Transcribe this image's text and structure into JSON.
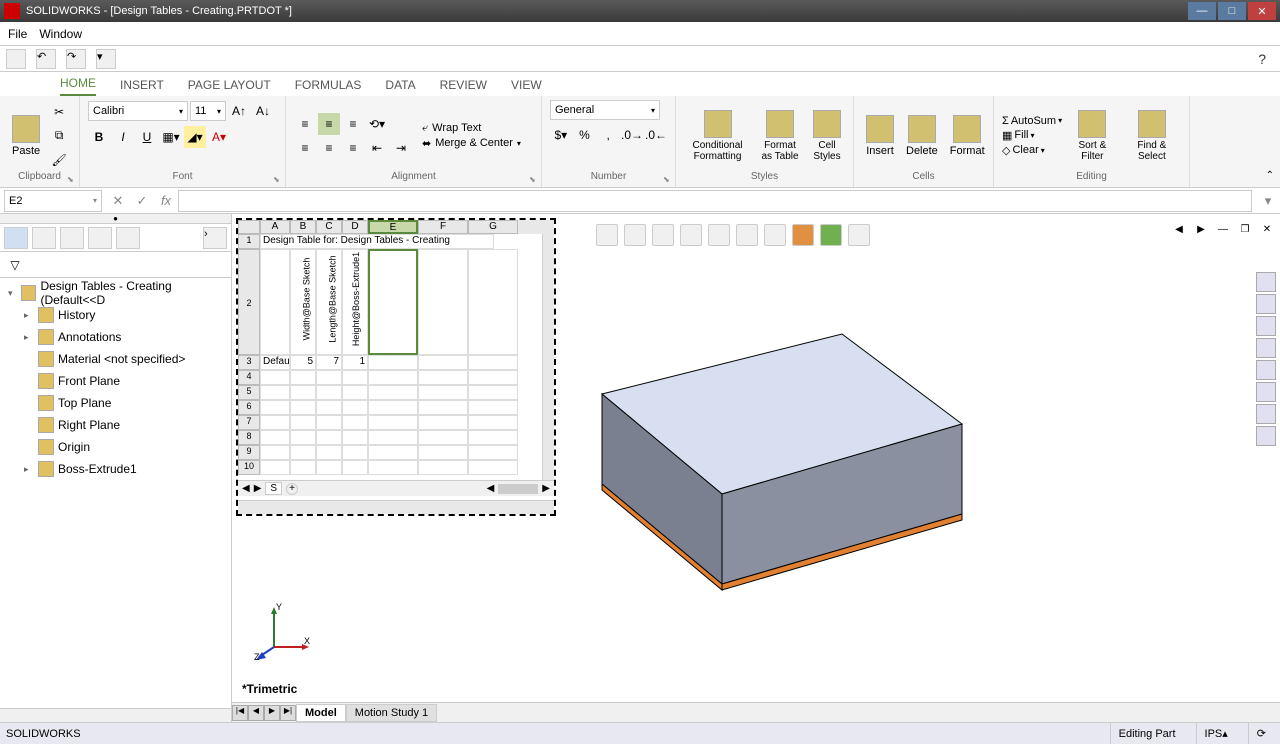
{
  "title": "SOLIDWORKS - [Design Tables - Creating.PRTDOT *]",
  "menus": {
    "file": "File",
    "window": "Window"
  },
  "help_tooltip": "?",
  "ribbon_tabs": {
    "home": "HOME",
    "insert": "INSERT",
    "page_layout": "PAGE LAYOUT",
    "formulas": "FORMULAS",
    "data": "DATA",
    "review": "REVIEW",
    "view": "VIEW"
  },
  "clipboard": {
    "paste": "Paste",
    "label": "Clipboard"
  },
  "font": {
    "name": "Calibri",
    "size": "11",
    "bold": "B",
    "italic": "I",
    "underline": "U",
    "label": "Font"
  },
  "alignment": {
    "wrap": "Wrap Text",
    "merge": "Merge & Center",
    "label": "Alignment"
  },
  "number": {
    "format": "General",
    "label": "Number"
  },
  "styles": {
    "cond": "Conditional Formatting",
    "fat": "Format as Table",
    "cell": "Cell Styles",
    "label": "Styles"
  },
  "cells": {
    "insert": "Insert",
    "delete": "Delete",
    "format": "Format",
    "label": "Cells"
  },
  "editing": {
    "autosum": "AutoSum",
    "fill": "Fill",
    "clear": "Clear",
    "sort": "Sort & Filter",
    "find": "Find & Select",
    "label": "Editing"
  },
  "formula_bar": {
    "name_box": "E2",
    "fx": "fx"
  },
  "feature_tree": {
    "root": "Design Tables - Creating  (Default<<D",
    "items": [
      "History",
      "Annotations",
      "Material <not specified>",
      "Front Plane",
      "Top Plane",
      "Right Plane",
      "Origin",
      "Boss-Extrude1"
    ]
  },
  "chart_data": {
    "type": "table",
    "title": "Design Table for: Design Tables - Creating",
    "columns": [
      "",
      "Width@Base Sketch",
      "Length@Base Sketch",
      "Height@Boss-Extrude1",
      "",
      "",
      ""
    ],
    "column_letters": [
      "A",
      "B",
      "C",
      "D",
      "E",
      "F",
      "G"
    ],
    "rows": [
      {
        "name": "Default",
        "values": [
          5,
          7,
          1
        ]
      }
    ],
    "active_cell": "E2"
  },
  "view_label": "*Trimetric",
  "bottom_tabs": {
    "model": "Model",
    "motion": "Motion Study 1"
  },
  "statusbar": {
    "app": "SOLIDWORKS",
    "state": "Editing Part",
    "units": "IPS"
  }
}
